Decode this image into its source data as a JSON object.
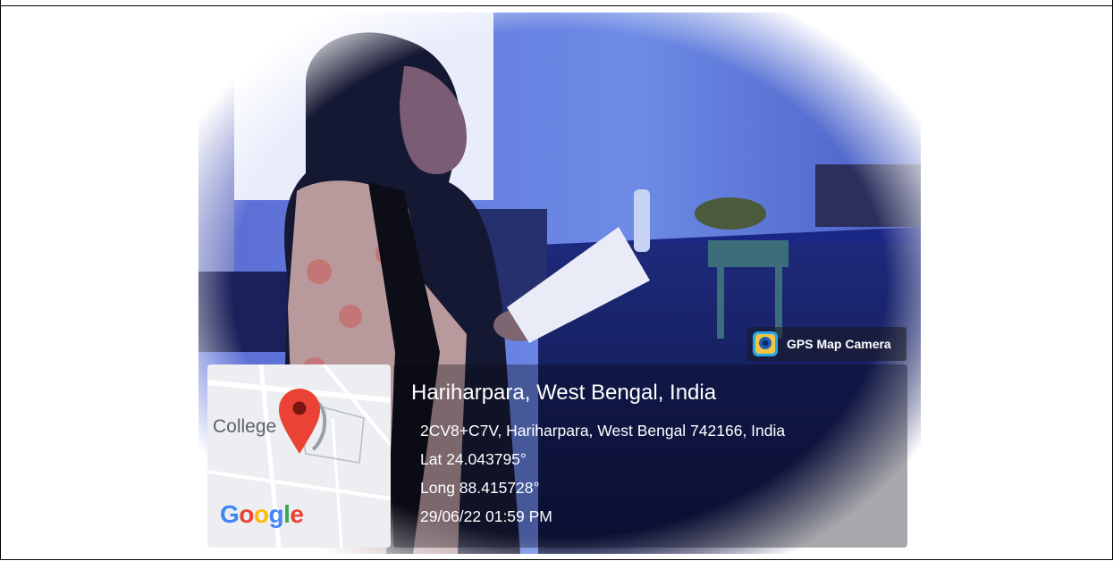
{
  "app": {
    "badge_label": "GPS Map Camera"
  },
  "map": {
    "place_label": "College",
    "brand": "Google"
  },
  "location": {
    "title": "Hariharpara, West Bengal, India",
    "address": "2CV8+C7V, Hariharpara, West Bengal 742166, India",
    "lat": "Lat 24.043795°",
    "long": "Long 88.415728°",
    "datetime": "29/06/22 01:59 PM"
  },
  "colors": {
    "pin": "#ea4335",
    "google_blue": "#4285f4",
    "google_red": "#ea4335",
    "google_yellow": "#fbbc05",
    "google_green": "#34a853"
  }
}
